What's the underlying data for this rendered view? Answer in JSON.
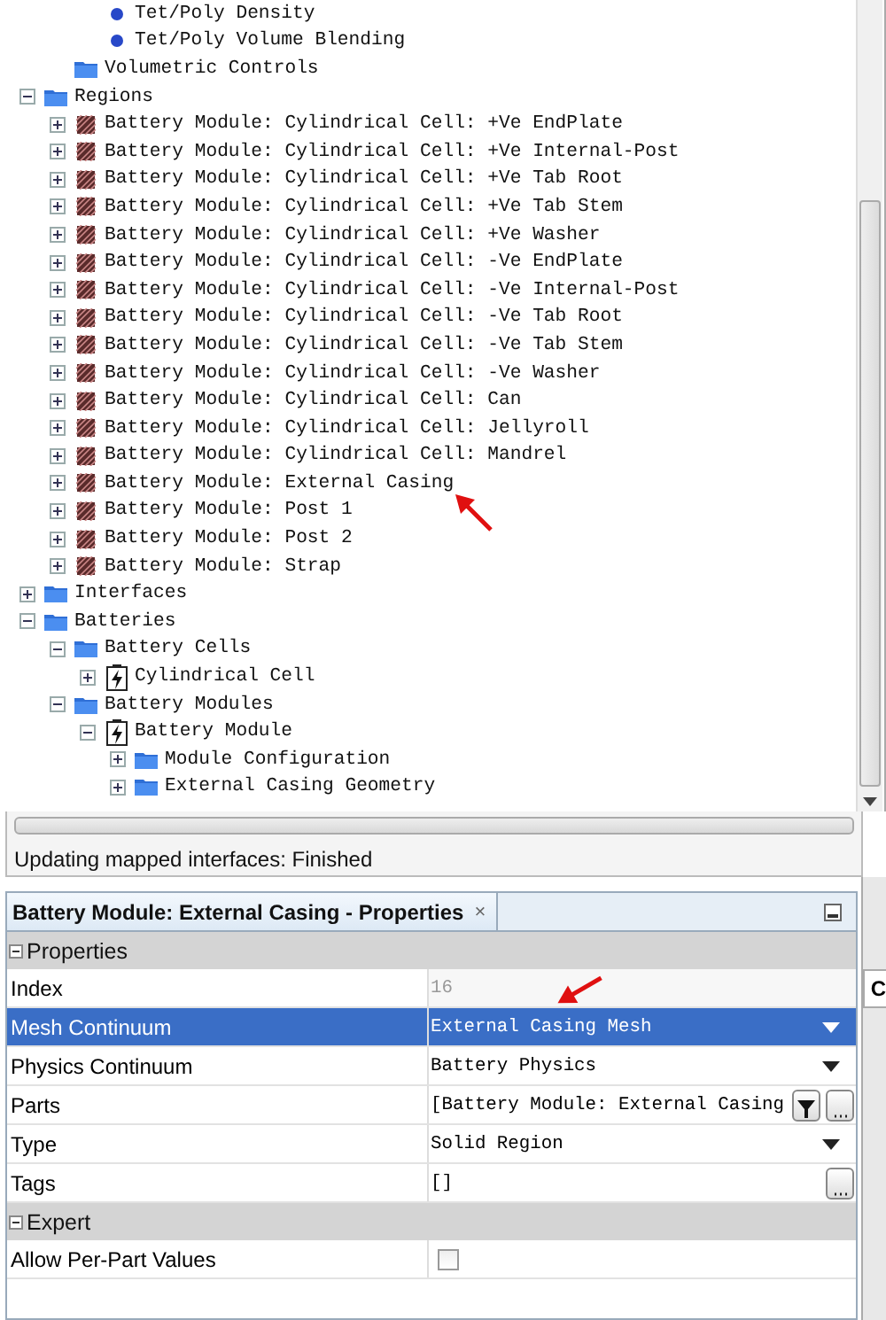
{
  "tree": {
    "items": [
      {
        "children": [
          {
            "children": [
              {
                "label": "Tet/Poly Density",
                "kind": "dot"
              },
              {
                "label": "Tet/Poly Volume Blending",
                "kind": "dot"
              }
            ]
          },
          {
            "label": "Volumetric Controls",
            "kind": "folder"
          }
        ]
      },
      {
        "label": "Regions",
        "kind": "folder",
        "expanded": true,
        "children": [
          {
            "label": "Battery Module: Cylindrical Cell: +Ve EndPlate",
            "kind": "region",
            "expanded": false
          },
          {
            "label": "Battery Module: Cylindrical Cell: +Ve Internal-Post",
            "kind": "region",
            "expanded": false
          },
          {
            "label": "Battery Module: Cylindrical Cell: +Ve Tab Root",
            "kind": "region",
            "expanded": false
          },
          {
            "label": "Battery Module: Cylindrical Cell: +Ve Tab Stem",
            "kind": "region",
            "expanded": false
          },
          {
            "label": "Battery Module: Cylindrical Cell: +Ve Washer",
            "kind": "region",
            "expanded": false
          },
          {
            "label": "Battery Module: Cylindrical Cell: -Ve EndPlate",
            "kind": "region",
            "expanded": false
          },
          {
            "label": "Battery Module: Cylindrical Cell: -Ve Internal-Post",
            "kind": "region",
            "expanded": false
          },
          {
            "label": "Battery Module: Cylindrical Cell: -Ve Tab Root",
            "kind": "region",
            "expanded": false
          },
          {
            "label": "Battery Module: Cylindrical Cell: -Ve Tab Stem",
            "kind": "region",
            "expanded": false
          },
          {
            "label": "Battery Module: Cylindrical Cell: -Ve Washer",
            "kind": "region",
            "expanded": false
          },
          {
            "label": "Battery Module: Cylindrical Cell: Can",
            "kind": "region",
            "expanded": false
          },
          {
            "label": "Battery Module: Cylindrical Cell: Jellyroll",
            "kind": "region",
            "expanded": false
          },
          {
            "label": "Battery Module: Cylindrical Cell: Mandrel",
            "kind": "region",
            "expanded": false
          },
          {
            "label": "Battery Module: External Casing",
            "kind": "region",
            "expanded": false
          },
          {
            "label": "Battery Module: Post 1",
            "kind": "region",
            "expanded": false
          },
          {
            "label": "Battery Module: Post 2",
            "kind": "region",
            "expanded": false
          },
          {
            "label": "Battery Module: Strap",
            "kind": "region",
            "expanded": false
          }
        ]
      },
      {
        "label": "Interfaces",
        "kind": "folder",
        "expanded": false
      },
      {
        "label": "Batteries",
        "kind": "folder",
        "expanded": true,
        "children": [
          {
            "label": "Battery Cells",
            "kind": "folder",
            "expanded": true,
            "children": [
              {
                "label": "Cylindrical Cell",
                "kind": "battery",
                "expanded": false
              }
            ]
          },
          {
            "label": "Battery Modules",
            "kind": "folder",
            "expanded": true,
            "children": [
              {
                "label": "Battery Module",
                "kind": "battery",
                "expanded": true,
                "children": [
                  {
                    "label": "Module Configuration",
                    "kind": "folder",
                    "expanded": false
                  },
                  {
                    "label": "External Casing Geometry",
                    "kind": "folder",
                    "expanded": false
                  }
                ]
              }
            ]
          }
        ]
      }
    ]
  },
  "status": {
    "message": "Updating mapped interfaces: Finished"
  },
  "properties_panel": {
    "title": "Battery Module: External Casing - Properties",
    "close_glyph": "×",
    "sections": [
      {
        "title": "Properties",
        "expanded": true,
        "rows": [
          {
            "label": "Index",
            "kind": "text",
            "value": "16",
            "editable": false,
            "selected": false
          },
          {
            "label": "Mesh Continuum",
            "kind": "dropdown",
            "value": "External Casing Mesh",
            "editable": true,
            "selected": true
          },
          {
            "label": "Physics Continuum",
            "kind": "dropdown",
            "value": "Battery Physics",
            "editable": true,
            "selected": false
          },
          {
            "label": "Parts",
            "kind": "parts",
            "value": "[Battery Module: External Casing",
            "editable": true,
            "selected": false
          },
          {
            "label": "Type",
            "kind": "dropdown",
            "value": "Solid Region",
            "editable": true,
            "selected": false
          },
          {
            "label": "Tags",
            "kind": "list",
            "value": "[]",
            "editable": true,
            "selected": false
          }
        ]
      },
      {
        "title": "Expert",
        "expanded": true,
        "rows": [
          {
            "label": "Allow Per-Part Values",
            "kind": "checkbox",
            "checked": false,
            "editable": true,
            "selected": false
          }
        ]
      }
    ]
  },
  "side_panel": {
    "title": "C"
  },
  "annotations": [
    {
      "kind": "arrow"
    },
    {
      "kind": "arrow"
    }
  ]
}
